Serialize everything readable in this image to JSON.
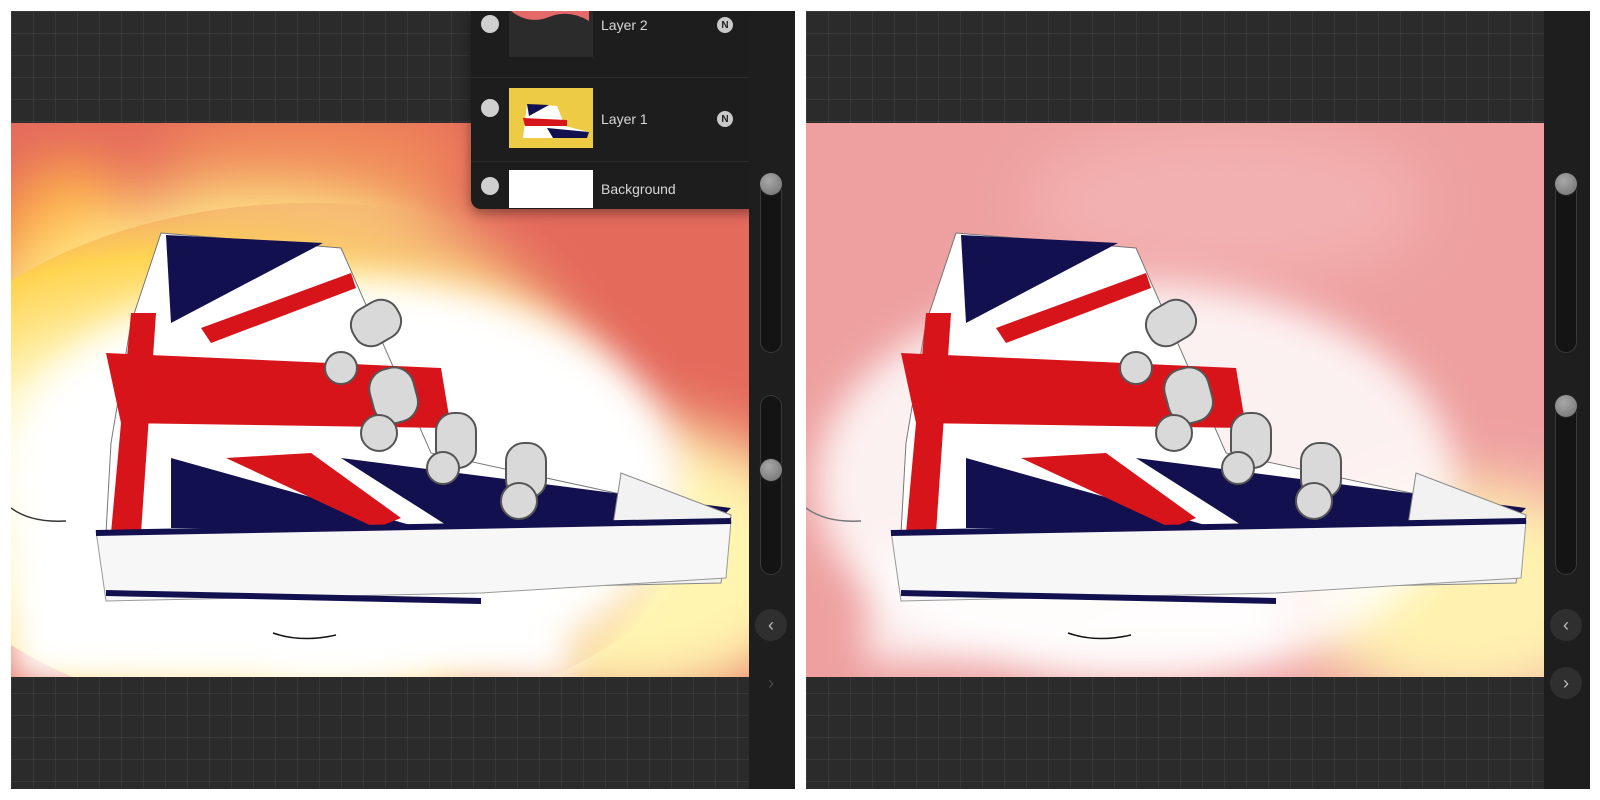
{
  "layers_panel": {
    "layers": [
      {
        "name": "Layer 2",
        "blend_mode": "N"
      },
      {
        "name": "Layer 1",
        "blend_mode": "N"
      },
      {
        "name": "Background"
      }
    ]
  },
  "icons": {
    "back_chevron": "‹",
    "forward_chevron": "›"
  },
  "colors": {
    "workspace": "#2b2b2b",
    "flag_red": "#d8141b",
    "flag_navy": "#13104f",
    "bg_left_warm": "#e46a5c",
    "bg_left_yellow": "#ffd24a",
    "bg_right_pink": "#eea0a0"
  }
}
